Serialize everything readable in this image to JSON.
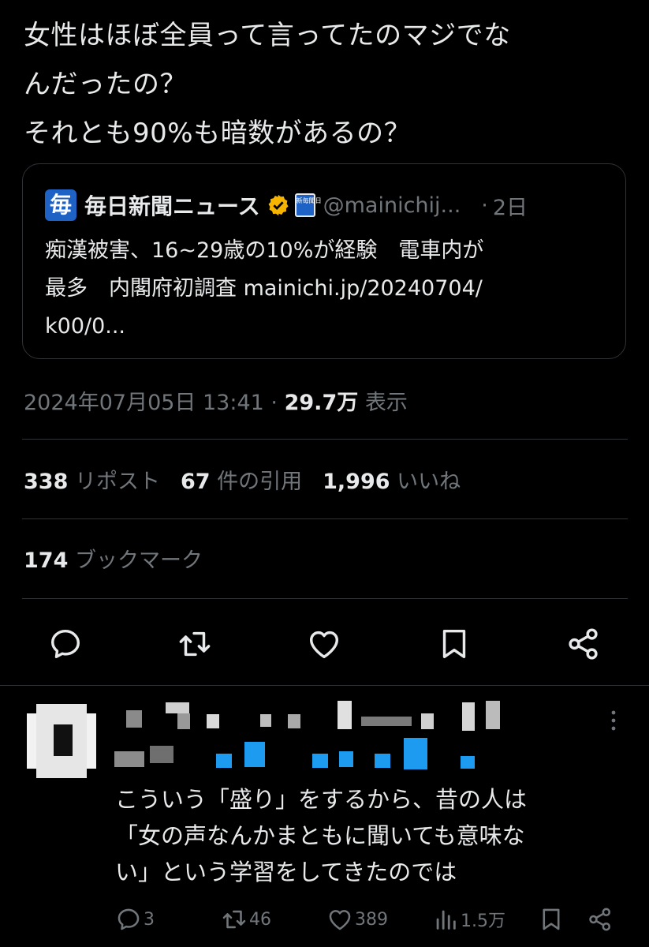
{
  "tweet": {
    "text_lines": [
      "女性はほぼ全員って言ってたのマジでな",
      "んだったの？",
      "それとも90%も暗数があるの？"
    ],
    "quote": {
      "logo_char": "毎",
      "account_name": "毎日新聞ニュース",
      "badge_text": "新毎聞日",
      "handle": "@mainichij...",
      "dot": "·",
      "time": "2日",
      "text_lines": [
        "痴漢被害、16~29歳の10%が経験　電車内が",
        "最多　内閣府初調査 mainichi.jp/20240704/",
        "k00/0..."
      ]
    },
    "timestamp": "2024年07月05日 13:41",
    "separator": "·",
    "views_count": "29.7万",
    "views_label": "表示",
    "stats": {
      "reposts_count": "338",
      "reposts_label": "リポスト",
      "quotes_count": "67",
      "quotes_label": "件の引用",
      "likes_count": "1,996",
      "likes_label": "いいね"
    },
    "bookmarks_count": "174",
    "bookmarks_label": "ブックマーク",
    "action_icons": [
      "reply-icon",
      "repost-icon",
      "like-icon",
      "bookmark-icon",
      "share-icon"
    ]
  },
  "reply": {
    "text_lines": [
      "こういう「盛り」をするから、昔の人は",
      "「女の声なんかまともに聞いても意味な",
      "い」という学習をしてきたのでは"
    ],
    "replies": "3",
    "reposts": "46",
    "likes": "389",
    "views": "1.5万"
  },
  "colors": {
    "background": "#000000",
    "text": "#e7e9ea",
    "muted": "#71767b",
    "divider": "#2f3336",
    "verified": "#f4b400",
    "accent_blue": "#1d9bf0"
  }
}
